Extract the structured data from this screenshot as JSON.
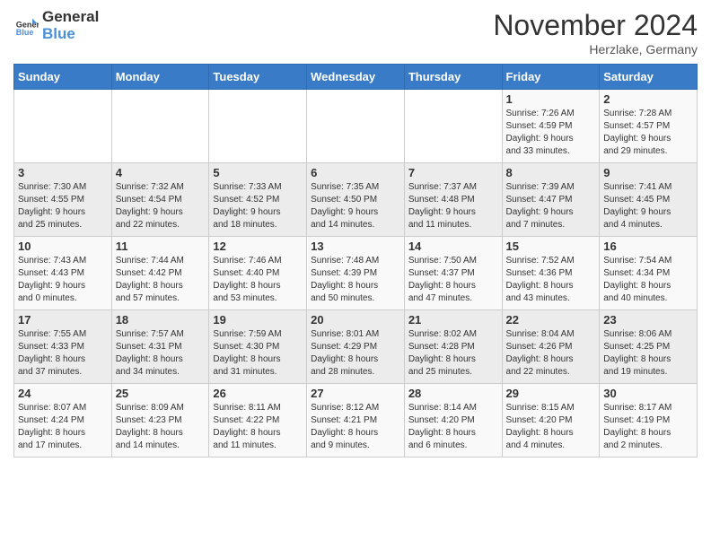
{
  "header": {
    "logo_general": "General",
    "logo_blue": "Blue",
    "month": "November 2024",
    "location": "Herzlake, Germany"
  },
  "weekdays": [
    "Sunday",
    "Monday",
    "Tuesday",
    "Wednesday",
    "Thursday",
    "Friday",
    "Saturday"
  ],
  "weeks": [
    [
      {
        "day": "",
        "info": ""
      },
      {
        "day": "",
        "info": ""
      },
      {
        "day": "",
        "info": ""
      },
      {
        "day": "",
        "info": ""
      },
      {
        "day": "",
        "info": ""
      },
      {
        "day": "1",
        "info": "Sunrise: 7:26 AM\nSunset: 4:59 PM\nDaylight: 9 hours\nand 33 minutes."
      },
      {
        "day": "2",
        "info": "Sunrise: 7:28 AM\nSunset: 4:57 PM\nDaylight: 9 hours\nand 29 minutes."
      }
    ],
    [
      {
        "day": "3",
        "info": "Sunrise: 7:30 AM\nSunset: 4:55 PM\nDaylight: 9 hours\nand 25 minutes."
      },
      {
        "day": "4",
        "info": "Sunrise: 7:32 AM\nSunset: 4:54 PM\nDaylight: 9 hours\nand 22 minutes."
      },
      {
        "day": "5",
        "info": "Sunrise: 7:33 AM\nSunset: 4:52 PM\nDaylight: 9 hours\nand 18 minutes."
      },
      {
        "day": "6",
        "info": "Sunrise: 7:35 AM\nSunset: 4:50 PM\nDaylight: 9 hours\nand 14 minutes."
      },
      {
        "day": "7",
        "info": "Sunrise: 7:37 AM\nSunset: 4:48 PM\nDaylight: 9 hours\nand 11 minutes."
      },
      {
        "day": "8",
        "info": "Sunrise: 7:39 AM\nSunset: 4:47 PM\nDaylight: 9 hours\nand 7 minutes."
      },
      {
        "day": "9",
        "info": "Sunrise: 7:41 AM\nSunset: 4:45 PM\nDaylight: 9 hours\nand 4 minutes."
      }
    ],
    [
      {
        "day": "10",
        "info": "Sunrise: 7:43 AM\nSunset: 4:43 PM\nDaylight: 9 hours\nand 0 minutes."
      },
      {
        "day": "11",
        "info": "Sunrise: 7:44 AM\nSunset: 4:42 PM\nDaylight: 8 hours\nand 57 minutes."
      },
      {
        "day": "12",
        "info": "Sunrise: 7:46 AM\nSunset: 4:40 PM\nDaylight: 8 hours\nand 53 minutes."
      },
      {
        "day": "13",
        "info": "Sunrise: 7:48 AM\nSunset: 4:39 PM\nDaylight: 8 hours\nand 50 minutes."
      },
      {
        "day": "14",
        "info": "Sunrise: 7:50 AM\nSunset: 4:37 PM\nDaylight: 8 hours\nand 47 minutes."
      },
      {
        "day": "15",
        "info": "Sunrise: 7:52 AM\nSunset: 4:36 PM\nDaylight: 8 hours\nand 43 minutes."
      },
      {
        "day": "16",
        "info": "Sunrise: 7:54 AM\nSunset: 4:34 PM\nDaylight: 8 hours\nand 40 minutes."
      }
    ],
    [
      {
        "day": "17",
        "info": "Sunrise: 7:55 AM\nSunset: 4:33 PM\nDaylight: 8 hours\nand 37 minutes."
      },
      {
        "day": "18",
        "info": "Sunrise: 7:57 AM\nSunset: 4:31 PM\nDaylight: 8 hours\nand 34 minutes."
      },
      {
        "day": "19",
        "info": "Sunrise: 7:59 AM\nSunset: 4:30 PM\nDaylight: 8 hours\nand 31 minutes."
      },
      {
        "day": "20",
        "info": "Sunrise: 8:01 AM\nSunset: 4:29 PM\nDaylight: 8 hours\nand 28 minutes."
      },
      {
        "day": "21",
        "info": "Sunrise: 8:02 AM\nSunset: 4:28 PM\nDaylight: 8 hours\nand 25 minutes."
      },
      {
        "day": "22",
        "info": "Sunrise: 8:04 AM\nSunset: 4:26 PM\nDaylight: 8 hours\nand 22 minutes."
      },
      {
        "day": "23",
        "info": "Sunrise: 8:06 AM\nSunset: 4:25 PM\nDaylight: 8 hours\nand 19 minutes."
      }
    ],
    [
      {
        "day": "24",
        "info": "Sunrise: 8:07 AM\nSunset: 4:24 PM\nDaylight: 8 hours\nand 17 minutes."
      },
      {
        "day": "25",
        "info": "Sunrise: 8:09 AM\nSunset: 4:23 PM\nDaylight: 8 hours\nand 14 minutes."
      },
      {
        "day": "26",
        "info": "Sunrise: 8:11 AM\nSunset: 4:22 PM\nDaylight: 8 hours\nand 11 minutes."
      },
      {
        "day": "27",
        "info": "Sunrise: 8:12 AM\nSunset: 4:21 PM\nDaylight: 8 hours\nand 9 minutes."
      },
      {
        "day": "28",
        "info": "Sunrise: 8:14 AM\nSunset: 4:20 PM\nDaylight: 8 hours\nand 6 minutes."
      },
      {
        "day": "29",
        "info": "Sunrise: 8:15 AM\nSunset: 4:20 PM\nDaylight: 8 hours\nand 4 minutes."
      },
      {
        "day": "30",
        "info": "Sunrise: 8:17 AM\nSunset: 4:19 PM\nDaylight: 8 hours\nand 2 minutes."
      }
    ]
  ]
}
